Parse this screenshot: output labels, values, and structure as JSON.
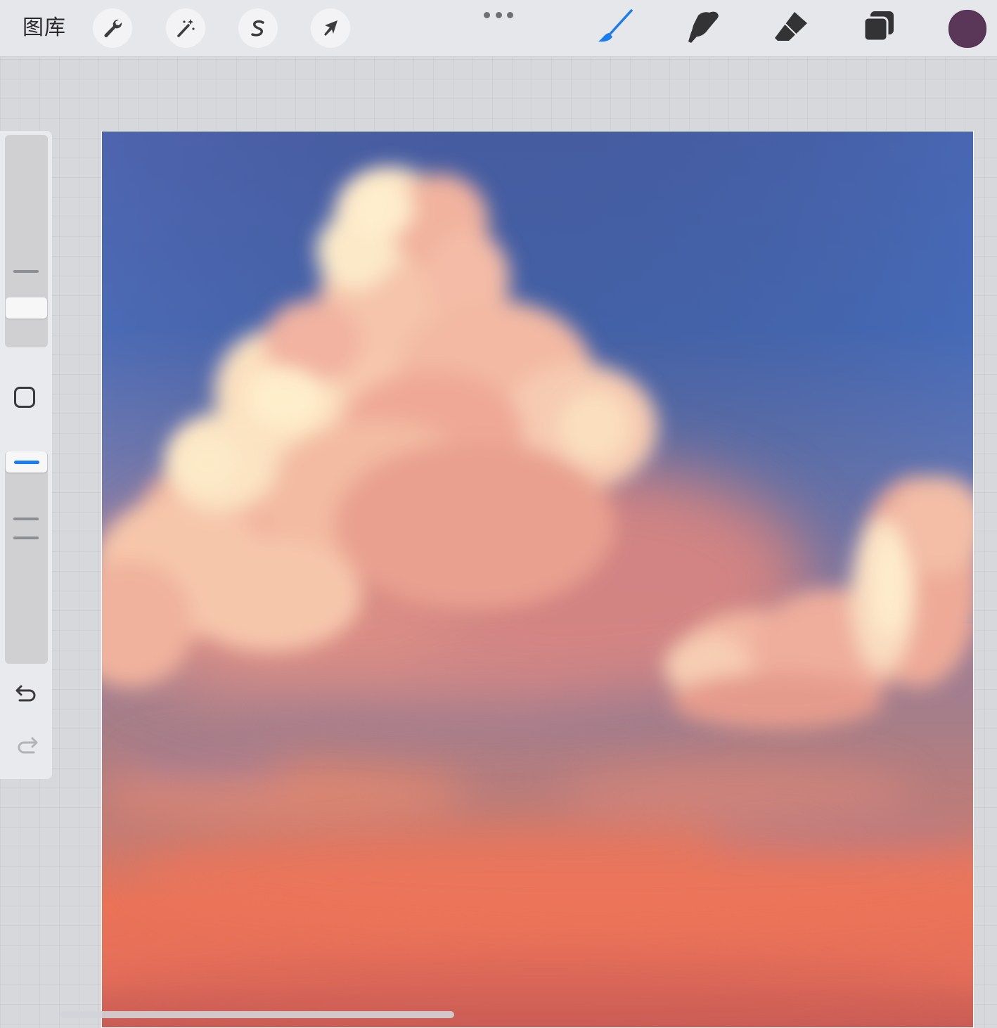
{
  "toolbar": {
    "gallery_label": "图库",
    "left_tools": [
      {
        "name": "actions",
        "icon": "wrench-icon"
      },
      {
        "name": "adjustments",
        "icon": "magic-wand-icon"
      },
      {
        "name": "selection",
        "icon": "selection-s-icon"
      },
      {
        "name": "transform",
        "icon": "arrow-cursor-icon"
      }
    ],
    "more_icon": "more-dots-icon",
    "right_tools": [
      {
        "name": "brush",
        "icon": "brush-icon",
        "active": true
      },
      {
        "name": "smudge",
        "icon": "smudge-finger-icon",
        "active": false
      },
      {
        "name": "eraser",
        "icon": "eraser-icon",
        "active": false
      },
      {
        "name": "layers",
        "icon": "layers-icon",
        "active": false
      }
    ],
    "current_color": "#5a3659"
  },
  "sidebar": {
    "brush_size_icon": "size-slider",
    "modify_icon": "modify-square-icon",
    "opacity_icon": "opacity-slider",
    "undo_icon": "undo-icon",
    "redo_icon": "redo-icon",
    "accent_color": "#1a7cf2"
  },
  "canvas": {
    "description_colors": {
      "sky_top": "#4f63af",
      "sky_mid": "#8a82ab",
      "sky_horizon": "#ec7458",
      "cloud_light": "#fbe3c4",
      "cloud_pink": "#efa390"
    }
  }
}
